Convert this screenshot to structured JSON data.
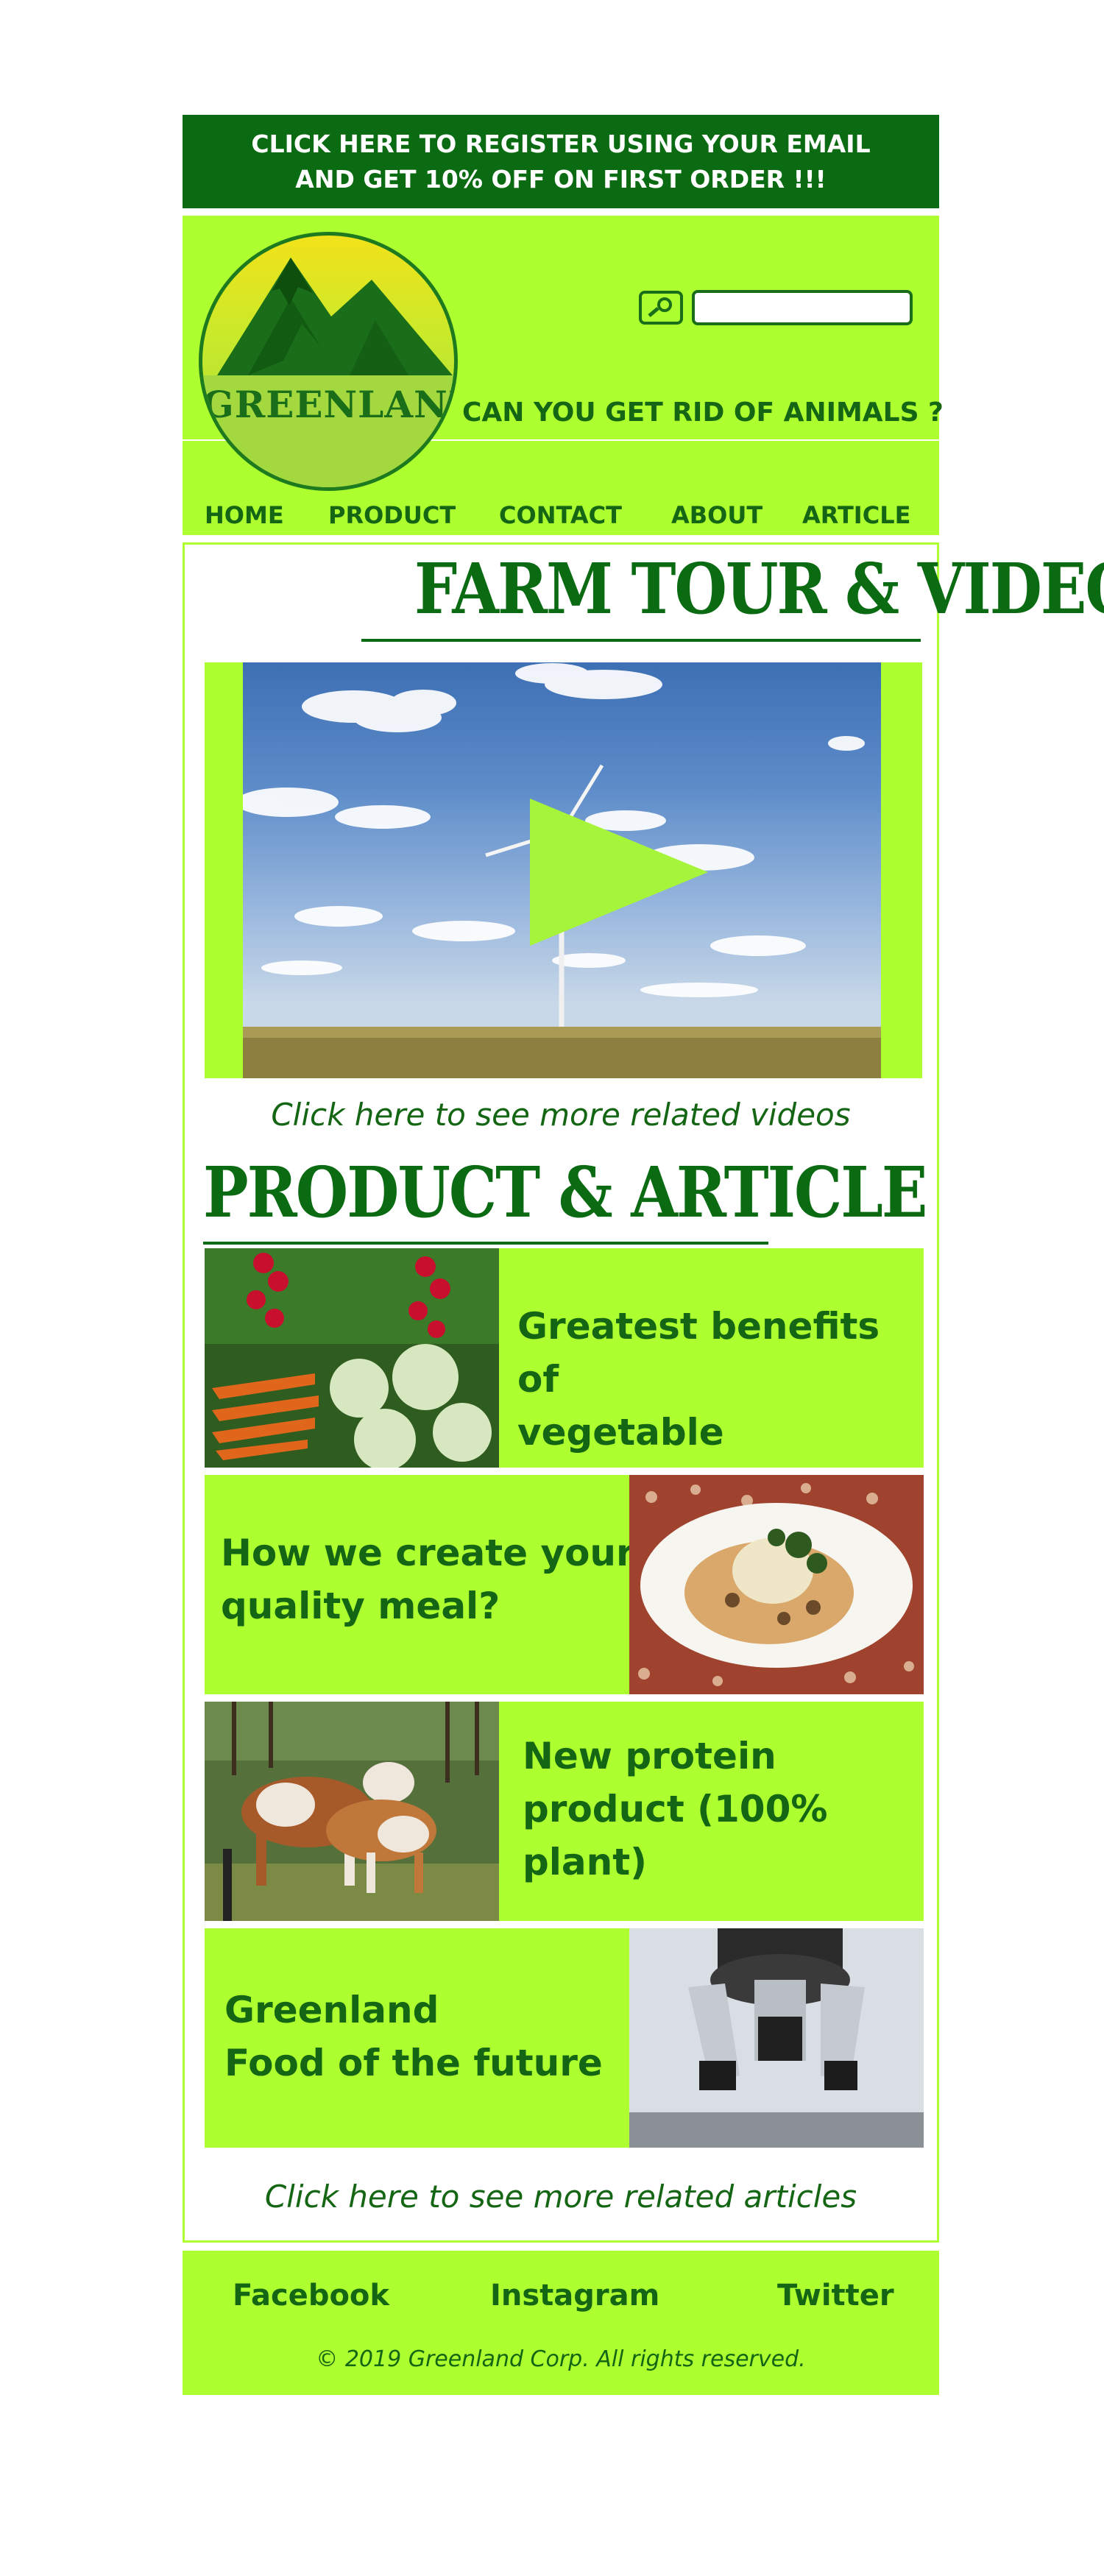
{
  "promo": {
    "line1": "CLICK HERE TO REGISTER USING YOUR EMAIL",
    "line2": "AND GET 10% OFF ON FIRST ORDER !!!"
  },
  "header": {
    "logo_text": "GREENLAND",
    "tagline": "CAN YOU GET RID OF ANIMALS ?",
    "search_icon": "search-icon",
    "search_value": ""
  },
  "nav": {
    "items": [
      {
        "label": "HOME"
      },
      {
        "label": "PRODUCT"
      },
      {
        "label": "CONTACT"
      },
      {
        "label": "ABOUT"
      },
      {
        "label": "ARTICLE"
      }
    ]
  },
  "main": {
    "video_section_title": "FARM TOUR & VIDEO",
    "video_icon": "play-icon",
    "video_link": "Click here to see more related videos",
    "articles_section_title": "PRODUCT & ARTICLE",
    "cards": [
      {
        "title_line1": "Greatest benefits of",
        "title_line2": "vegetable",
        "title_line3": "",
        "image": "vegetables-photo"
      },
      {
        "title_line1": "How we create your",
        "title_line2": "quality meal?",
        "title_line3": "",
        "image": "meal-plate-photo"
      },
      {
        "title_line1": "New protein",
        "title_line2": "product (100%",
        "title_line3": "plant)",
        "image": "cows-photo"
      },
      {
        "title_line1": "Greenland",
        "title_line2": "Food of the future",
        "title_line3": "",
        "image": "microscope-photo"
      }
    ],
    "articles_link": "Click here to see more related articles"
  },
  "footer": {
    "links": [
      {
        "label": "Facebook"
      },
      {
        "label": "Instagram"
      },
      {
        "label": "Twitter"
      }
    ],
    "copyright": "© 2019 Greenland Corp. All rights reserved."
  },
  "colors": {
    "dark_green": "#0b6b12",
    "lime": "#adff30",
    "text_green": "#146614",
    "white": "#ffffff"
  }
}
